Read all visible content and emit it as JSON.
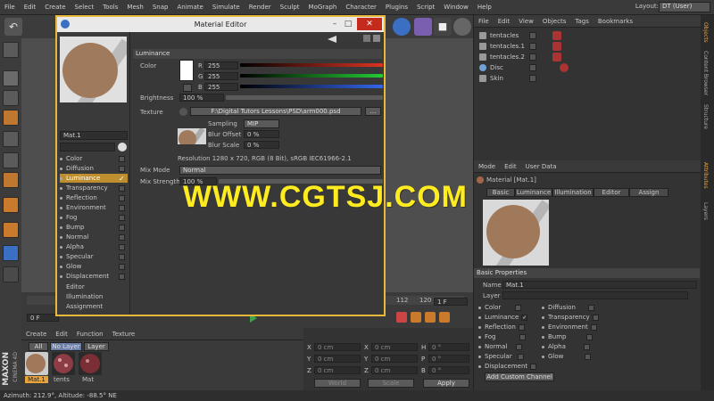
{
  "menu": [
    "File",
    "Edit",
    "Create",
    "Select",
    "Tools",
    "Mesh",
    "Snap",
    "Animate",
    "Simulate",
    "Render",
    "Sculpt",
    "MoGraph",
    "Character",
    "Plugins",
    "Script",
    "Window",
    "Help"
  ],
  "layout": {
    "label": "Layout:",
    "value": "DT (User)"
  },
  "object_manager": {
    "menu": [
      "File",
      "Edit",
      "View",
      "Objects",
      "Tags",
      "Bookmarks"
    ],
    "objects": [
      {
        "name": "tentacles"
      },
      {
        "name": "tentacles.1"
      },
      {
        "name": "tentacles.2"
      },
      {
        "name": "Disc"
      },
      {
        "name": "Skin"
      }
    ]
  },
  "right_tabs": [
    "Objects",
    "Content Browser",
    "Structure",
    "Attributes",
    "Layers"
  ],
  "material_editor": {
    "title": "Material Editor",
    "material_name": "Mat.1",
    "channels": [
      {
        "label": "Color",
        "checked": false
      },
      {
        "label": "Diffusion",
        "checked": false
      },
      {
        "label": "Luminance",
        "checked": true,
        "selected": true
      },
      {
        "label": "Transparency",
        "checked": false
      },
      {
        "label": "Reflection",
        "checked": false
      },
      {
        "label": "Environment",
        "checked": false
      },
      {
        "label": "Fog",
        "checked": false
      },
      {
        "label": "Bump",
        "checked": false
      },
      {
        "label": "Normal",
        "checked": false
      },
      {
        "label": "Alpha",
        "checked": false
      },
      {
        "label": "Specular",
        "checked": false
      },
      {
        "label": "Glow",
        "checked": false
      },
      {
        "label": "Displacement",
        "checked": false
      }
    ],
    "extra_items": [
      "Editor",
      "Illumination",
      "Assignment"
    ],
    "section": "Luminance",
    "color_label": "Color",
    "r": {
      "label": "R",
      "value": "255"
    },
    "g": {
      "label": "G",
      "value": "255"
    },
    "b": {
      "label": "B",
      "value": "255"
    },
    "brightness": {
      "label": "Brightness",
      "value": "100 %"
    },
    "texture": {
      "label": "Texture",
      "path": "F:\\Digital Tutors Lessons\\PSD\\arm000.psd",
      "more": "..."
    },
    "sampling": {
      "label": "Sampling",
      "value": "MIP"
    },
    "blur_offset": {
      "label": "Blur Offset",
      "value": "0 %"
    },
    "blur_scale": {
      "label": "Blur Scale",
      "value": "0 %"
    },
    "resolution": "Resolution 1280 x 720, RGB (8 Bit), sRGB IEC61966-2.1",
    "mix_mode": {
      "label": "Mix Mode",
      "value": "Normal"
    },
    "mix_strength": {
      "label": "Mix Strength",
      "value": "100 %"
    }
  },
  "watermark": "WWW.CGTSJ.COM",
  "attributes": {
    "menu": [
      "Mode",
      "Edit",
      "User Data"
    ],
    "title": "Material [Mat.1]",
    "tabs": [
      "Basic",
      "Luminance",
      "Illumination",
      "Editor",
      "Assign"
    ],
    "section": "Basic Properties",
    "name_label": "Name",
    "name_value": "Mat.1",
    "layer_label": "Layer",
    "channels_left": [
      {
        "label": "Color",
        "checked": false
      },
      {
        "label": "Luminance",
        "checked": true
      },
      {
        "label": "Reflection",
        "checked": false
      },
      {
        "label": "Fog",
        "checked": false
      },
      {
        "label": "Normal",
        "checked": false
      },
      {
        "label": "Specular",
        "checked": false
      },
      {
        "label": "Displacement",
        "checked": false
      }
    ],
    "channels_right": [
      {
        "label": "Diffusion",
        "checked": false
      },
      {
        "label": "Transparency",
        "checked": false
      },
      {
        "label": "Environment",
        "checked": false
      },
      {
        "label": "Bump",
        "checked": false
      },
      {
        "label": "Alpha",
        "checked": false
      },
      {
        "label": "Glow",
        "checked": false
      }
    ],
    "add_channel": "Add Custom Channel"
  },
  "timeline": {
    "frame_start": "0 F",
    "frame_end": "1 F",
    "ticks": [
      "112",
      "120"
    ]
  },
  "material_manager": {
    "menu": [
      "Create",
      "Edit",
      "Function",
      "Texture"
    ],
    "filters": [
      "All",
      "No Layer",
      "Layer"
    ],
    "materials": [
      "Mat.1",
      "tents",
      "Mat"
    ]
  },
  "coordinates": {
    "rows": [
      {
        "a": "X",
        "av": "0 cm",
        "b": "X",
        "bv": "0 cm",
        "c": "H",
        "cv": "0 °"
      },
      {
        "a": "Y",
        "av": "0 cm",
        "b": "Y",
        "bv": "0 cm",
        "c": "P",
        "cv": "0 °"
      },
      {
        "a": "Z",
        "av": "0 cm",
        "b": "Z",
        "bv": "0 cm",
        "c": "B",
        "cv": "0 °"
      }
    ],
    "world": "World",
    "scale": "Scale",
    "apply": "Apply"
  },
  "status": "Azimuth: 212.9°, Altitude: -88.5°  NE",
  "brand": {
    "maxon": "MAXON",
    "product": "CINEMA 4D"
  }
}
